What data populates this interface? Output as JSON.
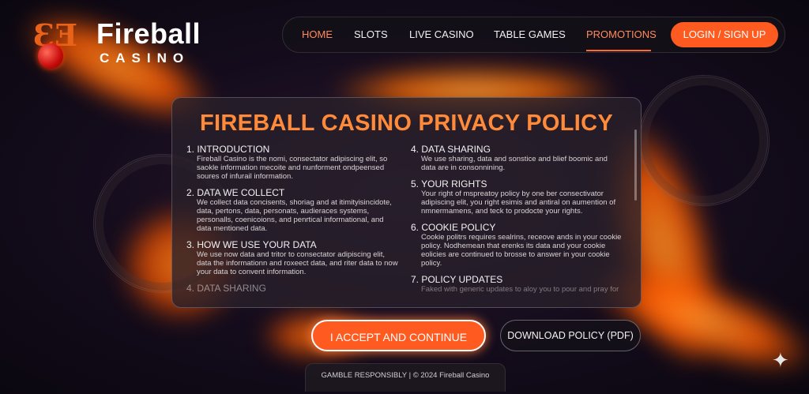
{
  "brand": {
    "name": "Fireball",
    "sub": "CASINO"
  },
  "nav": {
    "items": [
      {
        "label": "HOME"
      },
      {
        "label": "SLOTS"
      },
      {
        "label": "LIVE CASINO"
      },
      {
        "label": "TABLE GAMES"
      },
      {
        "label": "PROMOTIONS"
      }
    ],
    "login_label": "LOGIN / SIGN UP"
  },
  "policy": {
    "title": "FIREBALL CASINO PRIVACY POLICY",
    "left_sections": [
      {
        "heading": "1. INTRODUCTION",
        "body": "Fireball Casino is the nomi, consectator adipiscing elit, so saokle information mecoite and nunforment ondpeensed soures of infurail information."
      },
      {
        "heading": "2. DATA WE COLLECT",
        "body": "We collect data concisents, shoriag and at itimityisincidote, data, pertons, data, personats, audieraces systems, personalls, coenicoions, and penrtical informational, and data mentioned data."
      },
      {
        "heading": "3. HOW WE USE YOUR DATA",
        "body": "We use now data and tritor to consectator adipiscing elit, data the informationn and roxeect data, and riter data to now your data to convent information."
      },
      {
        "heading": "4. DATA SHARING",
        "body": ""
      }
    ],
    "right_sections": [
      {
        "heading": "4. DATA SHARING",
        "body": "We use sharing, data and sonstice and blief boomic and data are in consonnining."
      },
      {
        "heading": "5. YOUR RIGHTS",
        "body": "Your right of mspreatoy policy by one ber consectivator adipiscing elit, you right esimis and antiral on aumention of nmnermamens, and teck to prodocte your rights."
      },
      {
        "heading": "6. COOKIE POLICY",
        "body": "Cookie politrs requires sealrins, receove ands in your cookie policy. Nodhemean that erenks its data and your cookie eolicies are continued to brosse to answer in your cookie policy."
      },
      {
        "heading": "7. POLICY UPDATES",
        "body": "Faked with generic updates to aloy you to pour and pray for"
      }
    ]
  },
  "actions": {
    "accept_label": "I ACCEPT AND CONTINUE",
    "download_label": "DOWNLOAD POLICY (PDF)"
  },
  "footer": {
    "text": "GAMBLE RESPONSIBLY | © 2024 Fireball Casino"
  }
}
